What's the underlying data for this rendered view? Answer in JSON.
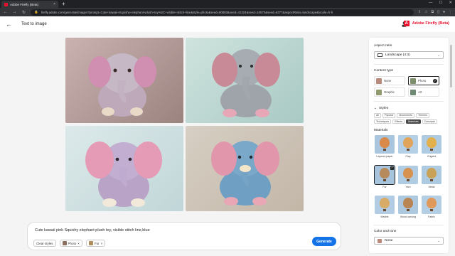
{
  "browser": {
    "tab_title": "Adobe Firefly (Beta)",
    "tab_close": "×",
    "new_tab": "+",
    "url": "firefly.adobe.com/generate/images?prompt=Cute+kawaii+Squishy+elephant+plush+toy%2C+visible+stitch+line&style=photo&seed=90803&seed=41324&seed=10570&seed=6377&aspectRatio=landscape&locale=fr-fr"
  },
  "header": {
    "title": "Text to image",
    "brand": "Adobe Firefly (Beta)",
    "brand_logo": "A"
  },
  "prompt": {
    "text": "Cute kawaii pink Squishy elephant plush toy, visible stitch line,blue",
    "clear_label": "Clear styles",
    "chips": [
      {
        "label": "Photo",
        "x": "×"
      },
      {
        "label": "Fur",
        "x": "×"
      }
    ],
    "generate_label": "Generate"
  },
  "panel": {
    "aspect_ratio": {
      "label": "Aspect ratio",
      "value": "Landscape (4:3)"
    },
    "content_type": {
      "label": "Content type",
      "options": [
        "None",
        "Photo",
        "Graphic",
        "Art"
      ],
      "selected": "Photo"
    },
    "styles": {
      "label": "Styles",
      "tabs": [
        "All",
        "Popular",
        "Movements",
        "Themes",
        "Techniques",
        "Effects",
        "Materials",
        "Concepts"
      ],
      "active_tab": "Materials"
    },
    "materials": {
      "label": "Materials",
      "items": [
        "Layered paper",
        "Clay",
        "Origami",
        "Fur",
        "Yarn",
        "Metal",
        "Marble",
        "Wood carving",
        "Fabric"
      ],
      "selected": "Fur"
    },
    "color_tone": {
      "label": "Color and tone",
      "value": "None"
    }
  },
  "colors": {
    "accent": "#1473e6",
    "brand": "#e8112d"
  }
}
